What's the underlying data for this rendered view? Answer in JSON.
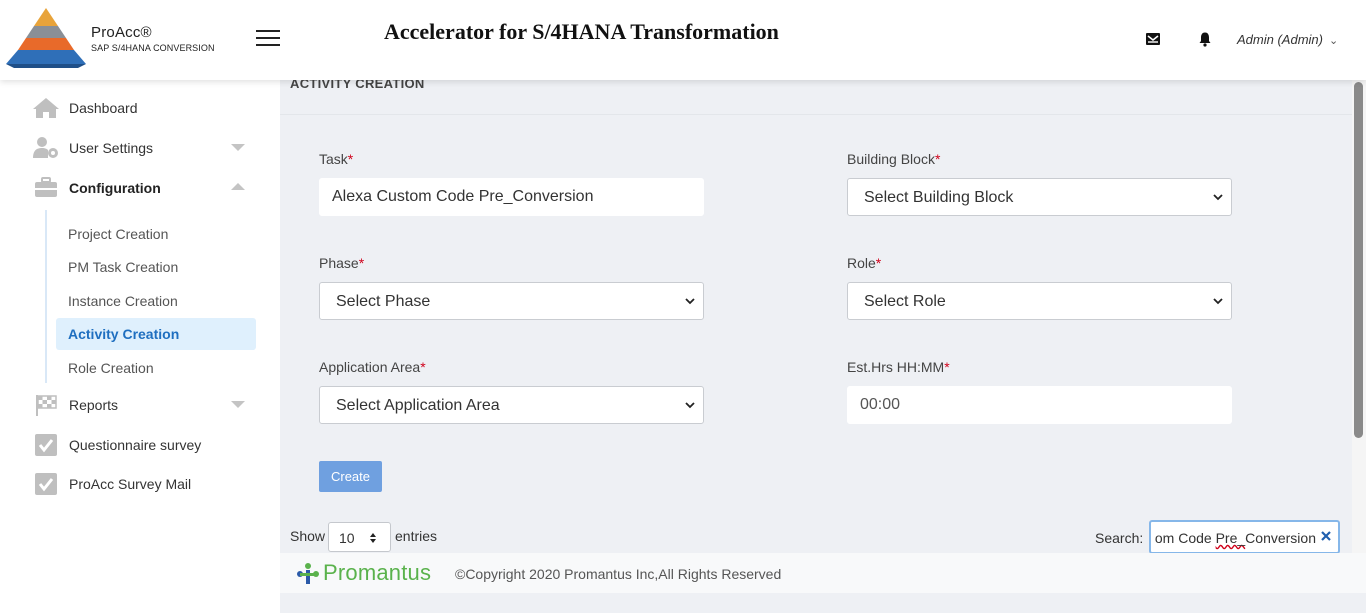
{
  "header": {
    "brand_name": "ProAcc®",
    "brand_sub": "SAP S/4HANA CONVERSION",
    "title": "Accelerator for S/4HANA Transformation",
    "user": "Admin (Admin)"
  },
  "sidebar": {
    "items": [
      {
        "label": "Dashboard",
        "icon": "home-icon"
      },
      {
        "label": "User Settings",
        "icon": "user-settings-icon"
      },
      {
        "label": "Configuration",
        "icon": "briefcase-icon"
      },
      {
        "label": "Reports",
        "icon": "checkered-flag-icon"
      },
      {
        "label": "Questionnaire survey",
        "icon": "checkbox-icon"
      },
      {
        "label": "ProAcc Survey Mail",
        "icon": "checkbox-icon"
      }
    ],
    "sub_items": [
      {
        "label": "Project Creation"
      },
      {
        "label": "PM Task Creation"
      },
      {
        "label": "Instance Creation"
      },
      {
        "label": "Activity Creation"
      },
      {
        "label": "Role Creation"
      }
    ]
  },
  "form": {
    "section_title": "ACTIVITY CREATION",
    "task_label": "Task",
    "task_value": "Alexa Custom Code Pre_Conversion",
    "building_block_label": "Building Block",
    "building_block_value": "Select Building Block",
    "phase_label": "Phase",
    "phase_value": "Select Phase",
    "role_label": "Role",
    "role_value": "Select Role",
    "app_area_label": "Application Area",
    "app_area_value": "Select Application Area",
    "est_hrs_label": "Est.Hrs HH:MM",
    "est_hrs_value": "00:00",
    "required_mark": "*",
    "create_label": "Create"
  },
  "table_controls": {
    "show_label": "Show",
    "entries_value": "10",
    "entries_label": "entries",
    "search_label": "Search:",
    "search_value_pre": "om Code ",
    "search_value_squig": "Pre_",
    "search_value_post": "Conversion"
  },
  "footer": {
    "logo_text": "Promantus",
    "copyright": "©Copyright 2020 Promantus Inc,All Rights Reserved"
  },
  "colors": {
    "accent": "#1f6fc0",
    "create_button": "#6fa0e0",
    "required": "#d0021b",
    "promantus_green": "#5ab24c"
  }
}
